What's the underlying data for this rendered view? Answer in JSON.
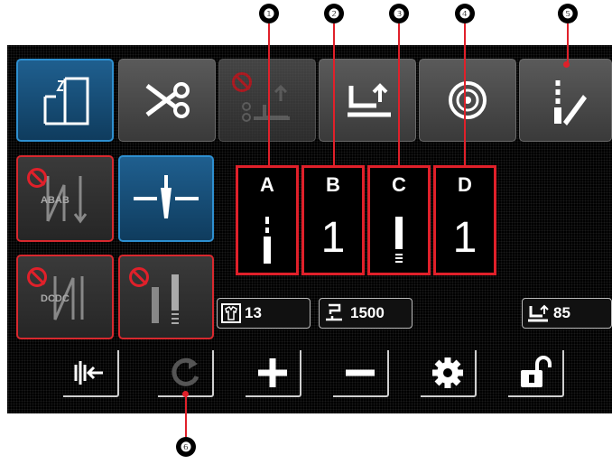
{
  "callouts": [
    "❶",
    "❷",
    "❸",
    "❹",
    "❺",
    "❻"
  ],
  "tiles": [
    {
      "letter": "A",
      "value": ""
    },
    {
      "letter": "B",
      "value": "1"
    },
    {
      "letter": "C",
      "value": ""
    },
    {
      "letter": "D",
      "value": "1"
    }
  ],
  "badges": {
    "piece_count": "13",
    "speed": "1500",
    "presser_height": "85"
  },
  "icons": {
    "pattern": "pattern-shape-icon",
    "thread_trim": "scissors-icon",
    "trim_lift": "trim-presser-lift-disabled-icon",
    "presser_lift": "presser-lift-icon",
    "winder": "bobbin-winder-icon",
    "edit": "edit-pen-icon",
    "reverse_ab": "reverse-stitch-abab-disabled-icon",
    "needle": "needle-position-icon",
    "reverse_dc": "reverse-stitch-dcdc-disabled-icon",
    "condensed": "condensed-stitch-disabled-icon",
    "to_origin": "return-to-origin-icon",
    "reset": "reset-counter-icon",
    "plus": "plus-icon",
    "minus": "minus-icon",
    "settings": "gear-icon",
    "lock": "unlock-icon"
  },
  "colors": {
    "accent_red": "#e0202a",
    "accent_blue": "#2d8fd0"
  }
}
